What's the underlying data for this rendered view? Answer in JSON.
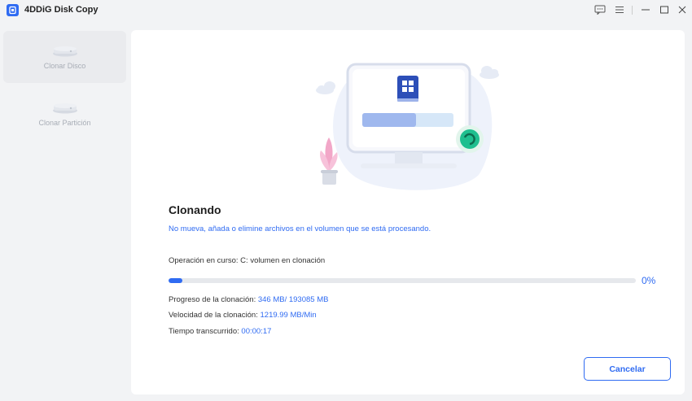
{
  "app": {
    "title": "4DDiG Disk Copy"
  },
  "window_controls": [
    "feedback-icon",
    "menu-icon",
    "minimize-icon",
    "maximize-icon",
    "close-icon"
  ],
  "sidebar": {
    "items": [
      {
        "label": "Clonar Disco",
        "icon": "disk-icon",
        "active": true
      },
      {
        "label": "Clonar Partición",
        "icon": "partition-icon",
        "active": false
      }
    ]
  },
  "main": {
    "heading": "Clonando",
    "warning": "No mueva, añada o elimine archivos en el volumen que se está procesando.",
    "operation": "Operación en curso: C: volumen en clonación",
    "progress": {
      "percent_label": "0%",
      "fraction": 0.03
    },
    "stats": [
      {
        "label": "Progreso de la clonación: ",
        "value": "346 MB/ 193085 MB"
      },
      {
        "label": "Velocidad de la clonación: ",
        "value": "1219.99 MB/Min"
      },
      {
        "label": "Tiempo transcurrido: ",
        "value": "00:00:17"
      }
    ],
    "cancel_label": "Cancelar"
  },
  "colors": {
    "accent": "#2f6bf2",
    "background": "#f2f3f5",
    "panel": "#ffffff"
  }
}
